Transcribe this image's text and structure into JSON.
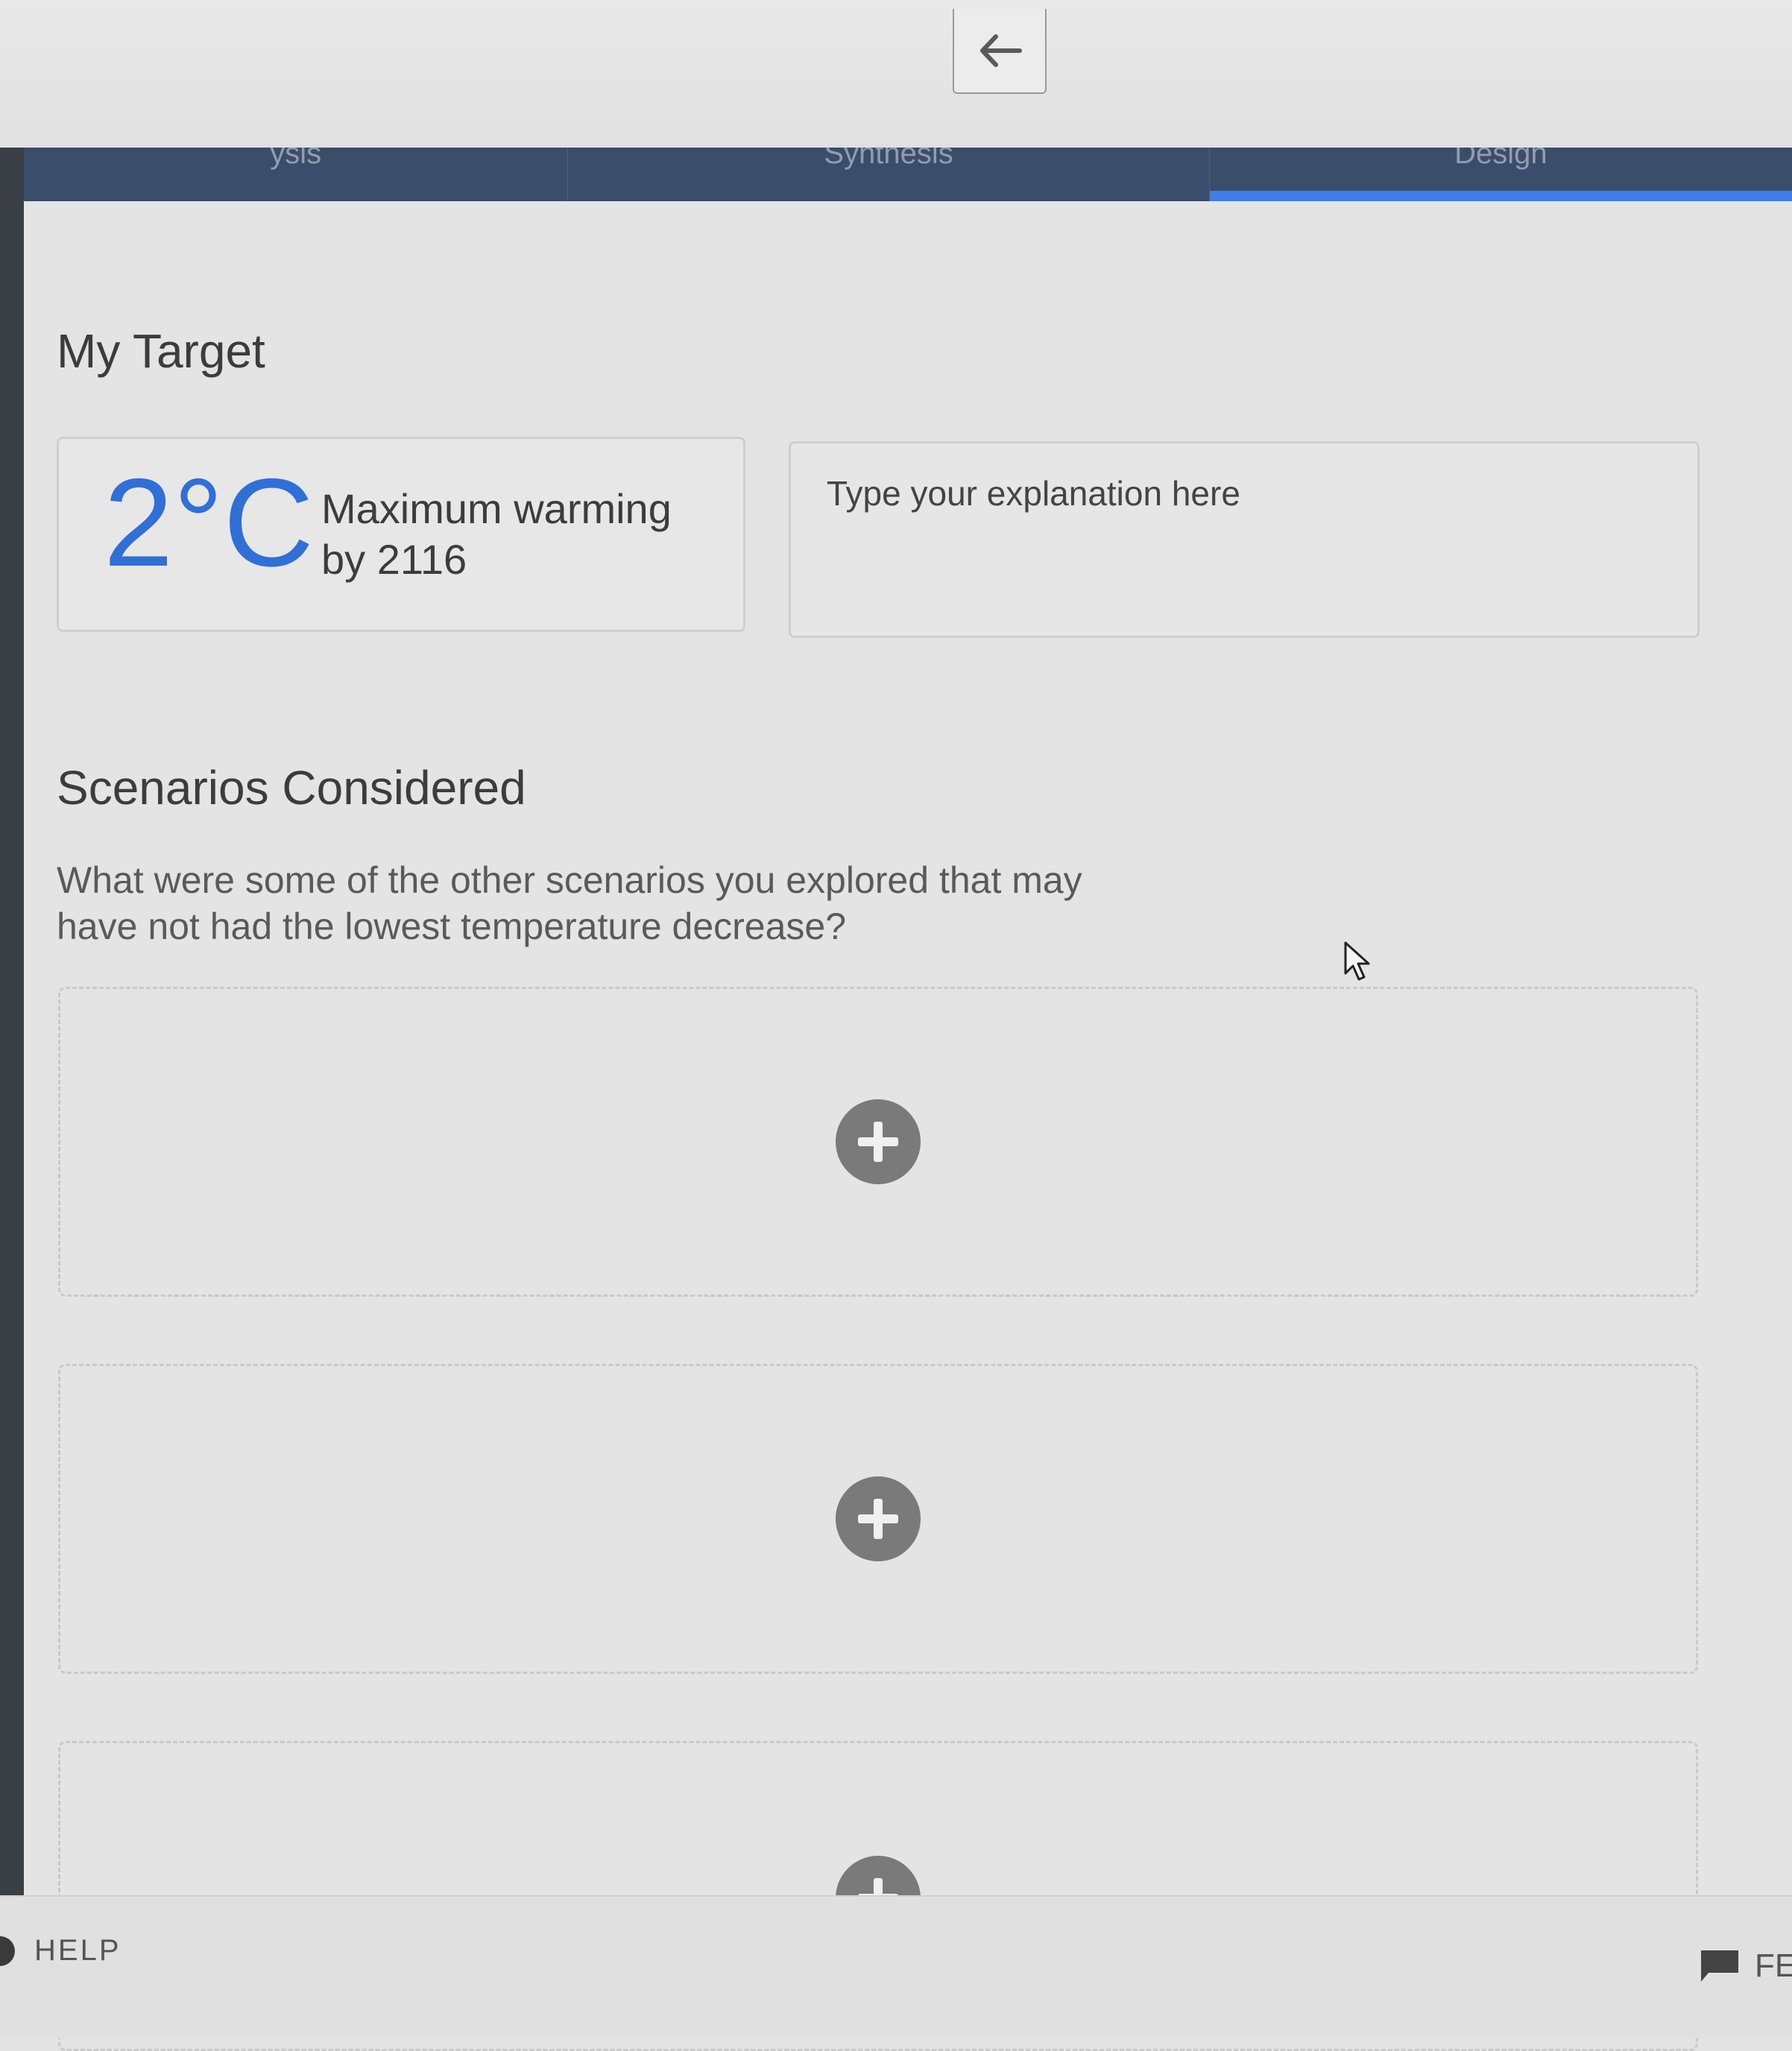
{
  "nav": {
    "tabs": [
      {
        "label": "ysis",
        "active": false
      },
      {
        "label": "Synthesis",
        "active": false
      },
      {
        "label": "Design",
        "active": true
      }
    ]
  },
  "target": {
    "heading": "My Target",
    "temperature": "2°C",
    "description": "Maximum warming by 2116",
    "explanation_placeholder": "Type your explanation here"
  },
  "scenarios": {
    "heading": "Scenarios Considered",
    "question": "What were some of the other scenarios you explored that may have not had the lowest temperature decrease?"
  },
  "footer": {
    "help_label": "HELP",
    "feedback_label": "FE"
  },
  "colors": {
    "accent": "#2f6fd6",
    "tabbar": "#3a4d6a",
    "active_tab_indicator": "#3f7ee6"
  }
}
